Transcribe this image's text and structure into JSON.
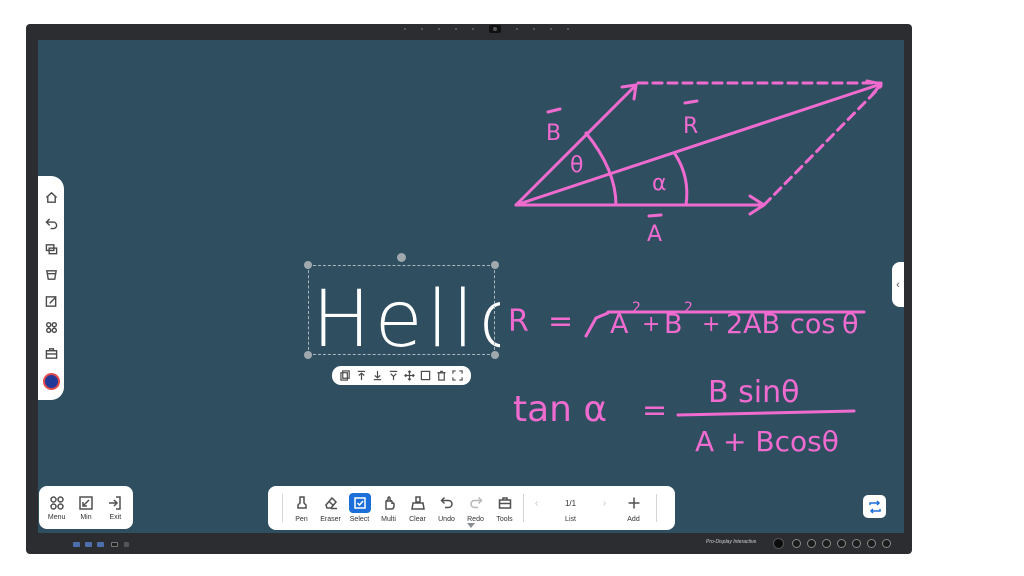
{
  "colors": {
    "board_background": "#2f4f61",
    "ink_pink": "#f06bd0",
    "ink_white": "#ffffff",
    "accent_blue": "#1c6fd8"
  },
  "side_toolbar": {
    "items": [
      {
        "icon": "home-icon"
      },
      {
        "icon": "back-icon"
      },
      {
        "icon": "windows-icon"
      },
      {
        "icon": "source-icon"
      },
      {
        "icon": "annotate-icon"
      },
      {
        "icon": "apps-icon"
      },
      {
        "icon": "toolbox-icon"
      },
      {
        "icon": "avatar-icon"
      }
    ]
  },
  "canvas": {
    "hello_text": "Hello",
    "diagram": {
      "vector_b": "B",
      "vector_r": "R",
      "vector_a": "A",
      "angle_theta": "θ",
      "angle_alpha": "α"
    },
    "equation1": {
      "lhs": "R",
      "equals": "=",
      "terms": [
        "A",
        "2",
        "+",
        "B",
        "2",
        "+",
        "2AB",
        "cos",
        "θ"
      ]
    },
    "equation2": {
      "lhs": "tan α",
      "equals": "=",
      "numerator": "B sinθ",
      "denominator": "A + Bcosθ"
    }
  },
  "selection_toolbar": {
    "items": [
      "copy-icon",
      "bring-to-front-icon",
      "send-to-back-icon",
      "pin-icon",
      "move-icon",
      "frame-icon",
      "delete-icon",
      "fullscreen-icon"
    ]
  },
  "left_toolbar": {
    "menu": "Menu",
    "min": "Min",
    "exit": "Exit"
  },
  "main_toolbar": {
    "pen": "Pen",
    "eraser": "Eraser",
    "select": "Select",
    "multi": "Multi",
    "clear": "Clear",
    "undo": "Undo",
    "redo": "Redo",
    "tools": "Tools",
    "page_indicator": "1/1",
    "list": "List",
    "add": "Add",
    "active_tool": "Select"
  },
  "bezel": {
    "brand": "Pro-Display Interactive"
  }
}
